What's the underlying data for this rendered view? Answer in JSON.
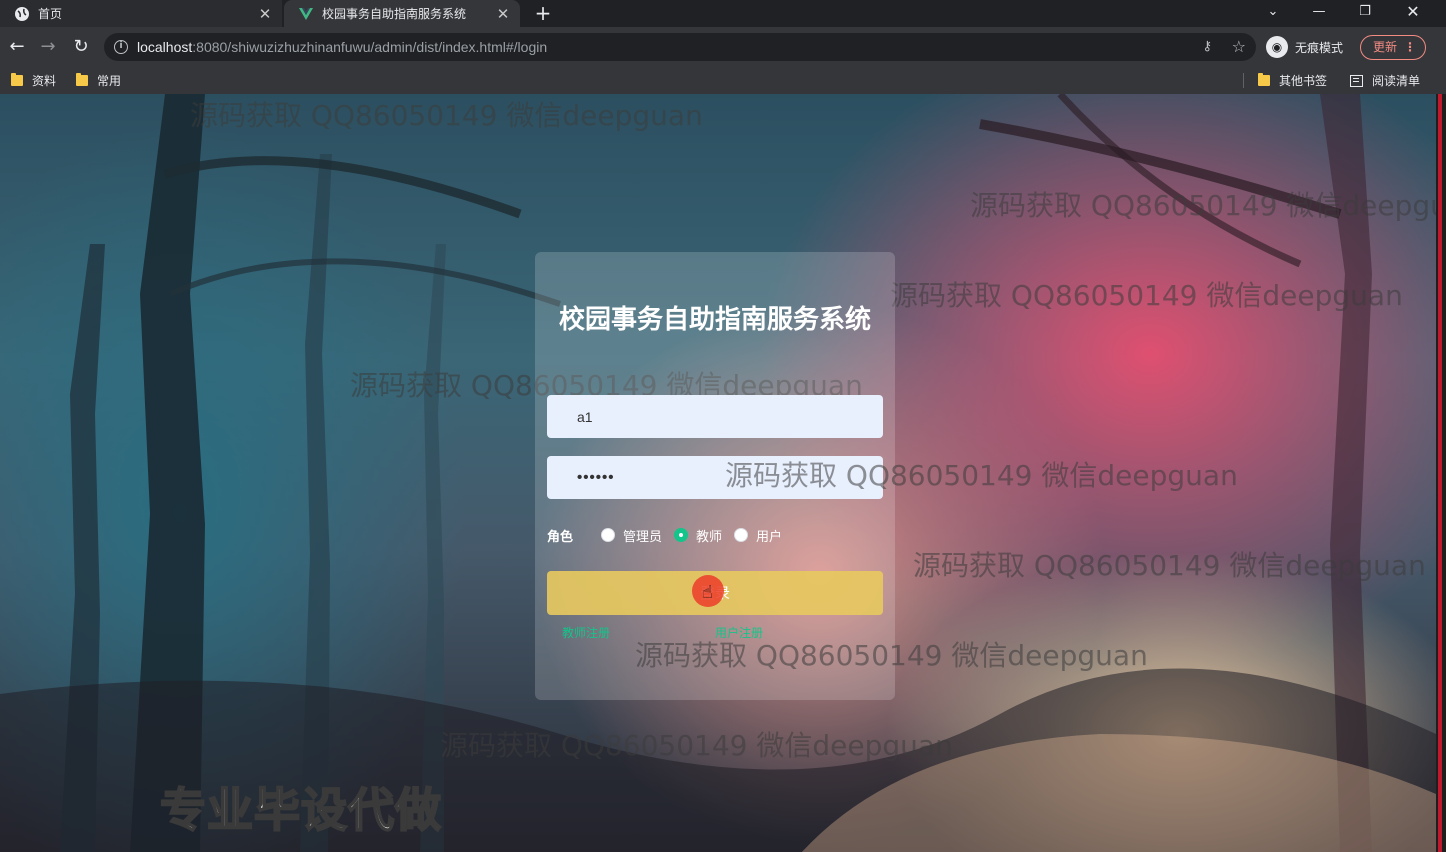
{
  "browser": {
    "tabs": [
      {
        "title": "首页",
        "active": false
      },
      {
        "title": "校园事务自助指南服务系统",
        "active": true
      }
    ],
    "url_host": "localhost",
    "url_rest": ":8080/shiwuzizhuzhinanfuwu/admin/dist/index.html#/login",
    "incognito_label": "无痕模式",
    "update_label": "更新",
    "bookmarks": [
      "资料",
      "常用",
      "其他书签",
      "阅读清单"
    ]
  },
  "login": {
    "title": "校园事务自助指南服务系统",
    "username": "a1",
    "password_mask": "••••••",
    "role_label": "角色",
    "roles": [
      "管理员",
      "教师",
      "用户"
    ],
    "selected_role": "教师",
    "login_button": "登录",
    "link_teacher_register": "教师注册",
    "link_user_register": "用户注册"
  },
  "watermark_text": "源码获取 QQ86050149 微信deepguan",
  "promo_text": "专业毕设代做",
  "colors": {
    "accent": "#13c58a",
    "login_button": "#e6c85f",
    "card_bg": "rgba(255,255,255,0.18)"
  }
}
